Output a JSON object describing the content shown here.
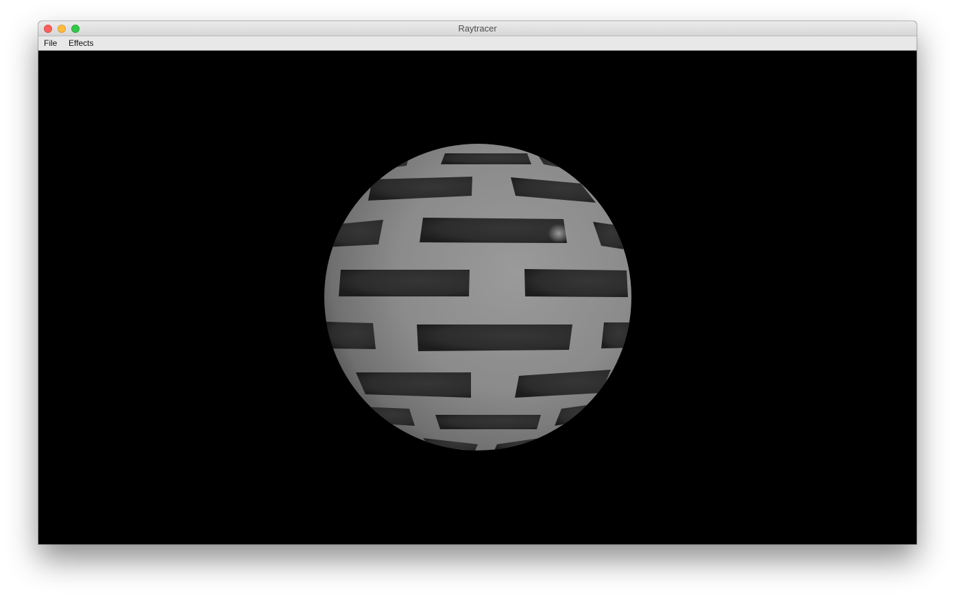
{
  "window": {
    "title": "Raytracer"
  },
  "menubar": {
    "items": [
      {
        "label": "File"
      },
      {
        "label": "Effects"
      }
    ]
  },
  "render": {
    "background_color": "#000000",
    "sphere_color": "#8c8c8c",
    "stripe_color": "#2f2f2f"
  }
}
